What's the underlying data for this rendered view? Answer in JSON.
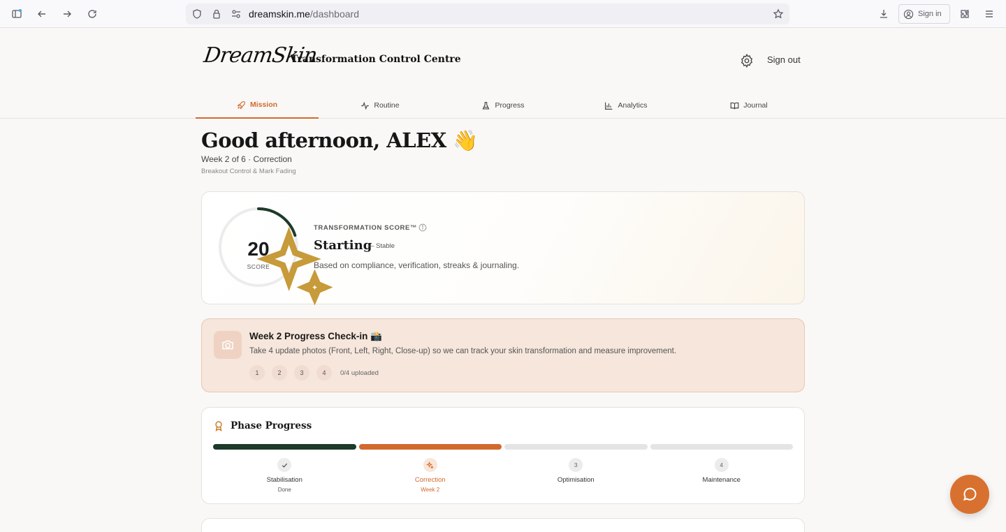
{
  "browser": {
    "url_domain": "dreamskin.me",
    "url_path": "/dashboard",
    "signin_label": "Sign in"
  },
  "header": {
    "logo_text": "DreamSkin",
    "title": "Transformation Control Centre",
    "signout_label": "Sign out"
  },
  "nav": {
    "tabs": [
      {
        "label": "Mission",
        "icon": "rocket-icon",
        "active": true
      },
      {
        "label": "Routine",
        "icon": "activity-icon",
        "active": false
      },
      {
        "label": "Progress",
        "icon": "flask-icon",
        "active": false
      },
      {
        "label": "Analytics",
        "icon": "bar-chart-icon",
        "active": false
      },
      {
        "label": "Journal",
        "icon": "book-open-icon",
        "active": false
      }
    ]
  },
  "greeting": {
    "title": "Good afternoon, ALEX 👋",
    "week": "Week 2 of 6 · Correction",
    "focus": "Breakout Control & Mark Fading"
  },
  "score": {
    "value": "20",
    "unit_label": "SCORE",
    "progress_fraction": 0.2,
    "label": "TRANSFORMATION SCORE™",
    "status": "Starting",
    "trend": "— Stable",
    "description": "Based on compliance, verification, streaks & journaling."
  },
  "checkin": {
    "title": "Week 2 Progress Check-in 📸",
    "description": "Take 4 update photos (Front, Left, Right, Close-up) so we can track your skin transformation and measure improvement.",
    "slots": [
      "1",
      "2",
      "3",
      "4"
    ],
    "status": "0/4 uploaded"
  },
  "phase": {
    "title": "Phase Progress",
    "phases": [
      {
        "name": "Stabilisation",
        "sub": "Done",
        "state": "done",
        "marker": ""
      },
      {
        "name": "Correction",
        "sub": "Week 2",
        "state": "current",
        "marker": ""
      },
      {
        "name": "Optimisation",
        "sub": "",
        "state": "upcoming",
        "marker": "3"
      },
      {
        "name": "Maintenance",
        "sub": "",
        "state": "upcoming",
        "marker": "4"
      }
    ]
  },
  "colors": {
    "accent": "#d2692c",
    "done": "#1e3a2a",
    "ring_track": "#ececec"
  }
}
